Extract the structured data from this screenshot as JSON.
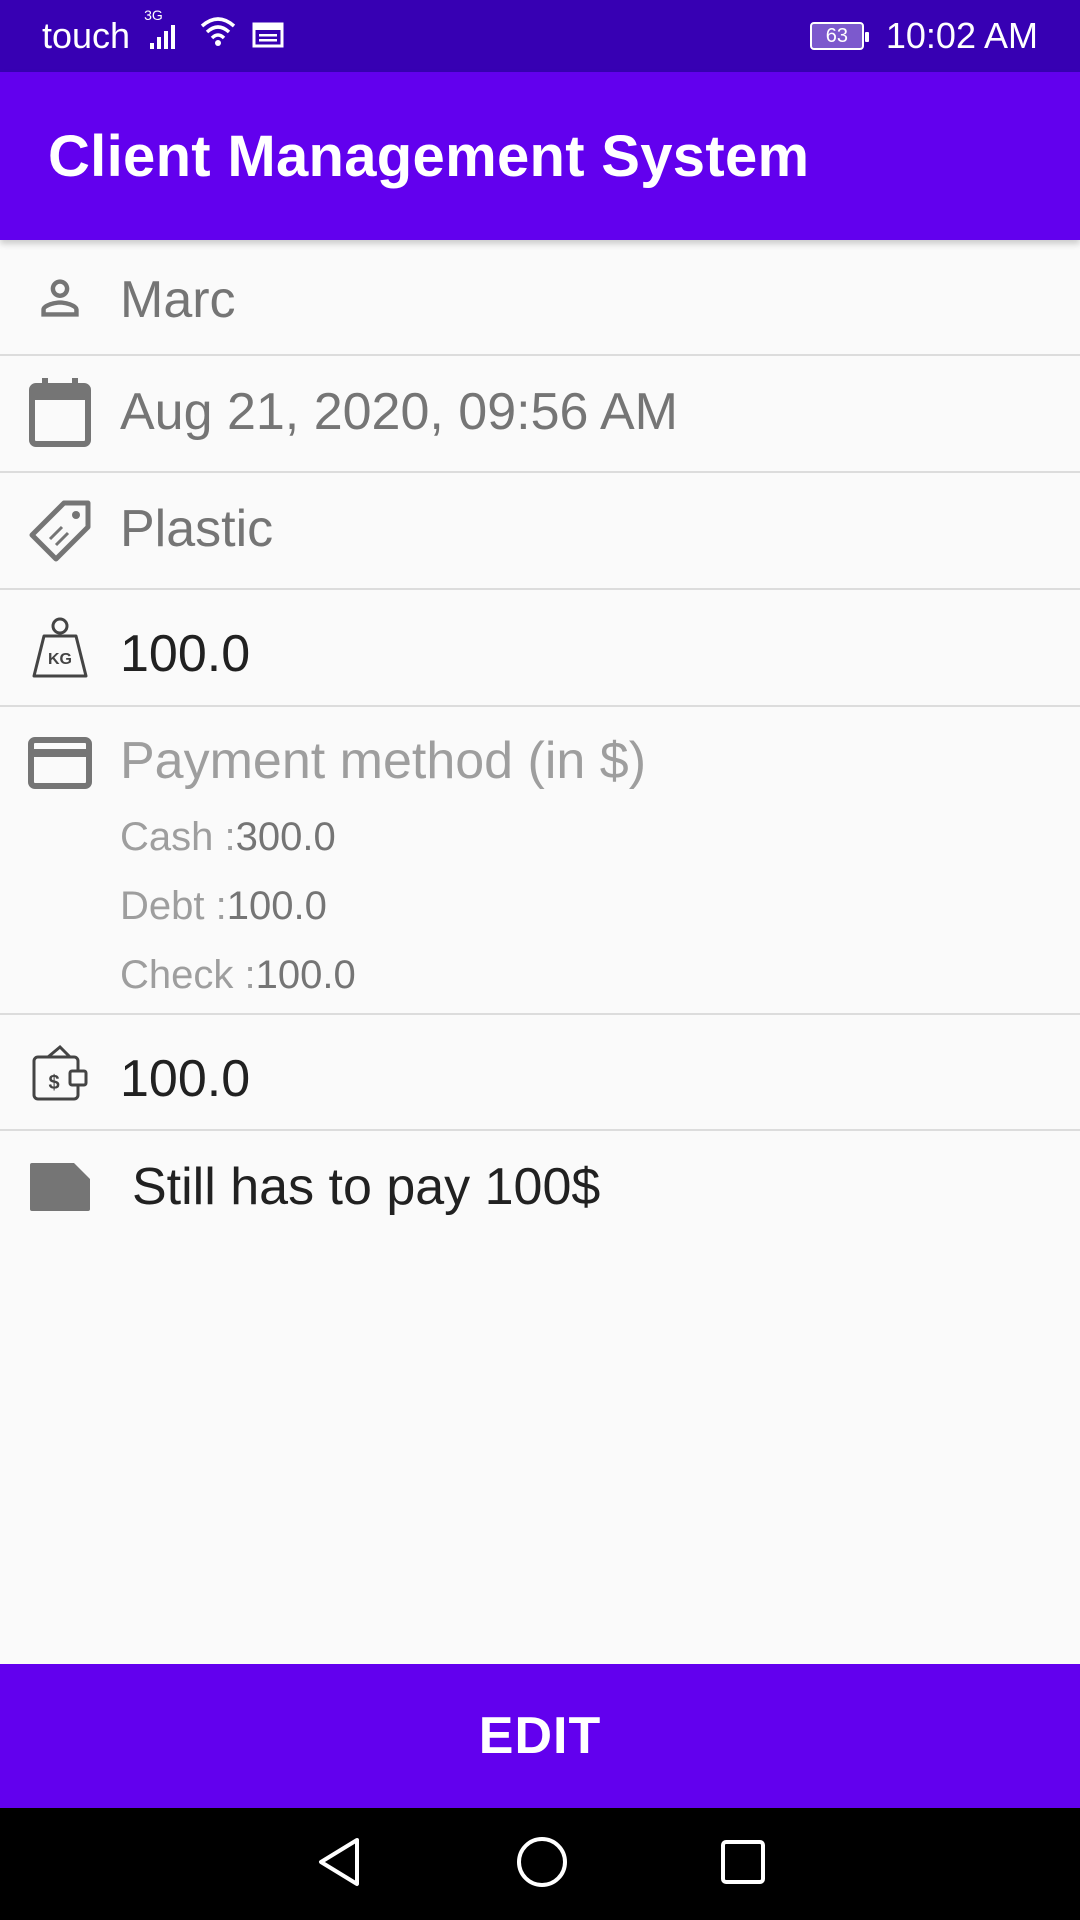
{
  "status_bar": {
    "carrier": "touch",
    "network": "3G",
    "battery": "63",
    "time": "10:02 AM",
    "icons": [
      "signal-icon",
      "wifi-icon",
      "calendar-notification-icon",
      "battery-icon"
    ]
  },
  "app_bar": {
    "title": "Client Management System",
    "color": "#6200ee"
  },
  "details": {
    "name": "Marc",
    "datetime": "Aug 21, 2020, 09:56 AM",
    "material": "Plastic",
    "weight": "100.0",
    "payment": {
      "label": "Payment method (in $)",
      "cash_label": "Cash :",
      "cash_value": "300.0",
      "debt_label": "Debt :",
      "debt_value": "100.0",
      "check_label": "Check :",
      "check_value": "100.0"
    },
    "balance": "100.0",
    "note": "Still has to pay 100$"
  },
  "edit_button": {
    "label": "EDIT",
    "color": "#6200ee"
  },
  "nav": {
    "icons": [
      "back-icon",
      "home-icon",
      "recents-icon"
    ]
  }
}
